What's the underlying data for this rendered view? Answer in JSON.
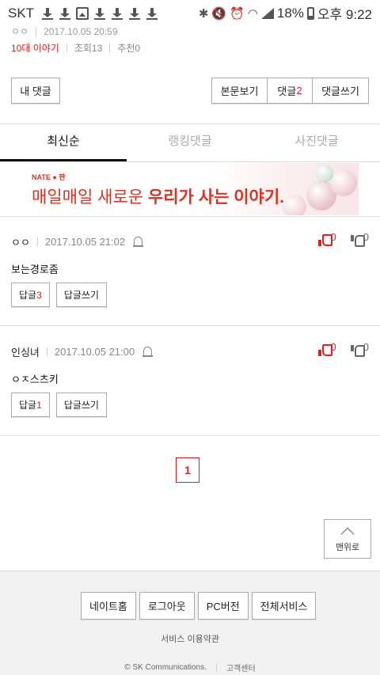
{
  "status_bar": {
    "carrier": "SKT",
    "battery": "18%",
    "time": "오후 9:22"
  },
  "post": {
    "author": "ㅇㅇ",
    "date": "2017.10.05 20:59",
    "category": "10대 이야기",
    "views": "조회13",
    "recommend": "추천0"
  },
  "toolbar": {
    "my_comments": "내 댓글",
    "view_post": "본문보기",
    "comments_label": "댓글",
    "comments_count": "2",
    "write_comment": "댓글쓰기"
  },
  "tabs": [
    {
      "label": "최신순",
      "active": true
    },
    {
      "label": "랭킹댓글",
      "active": false
    },
    {
      "label": "사진댓글",
      "active": false
    }
  ],
  "banner": {
    "brand": "NATE ● 판",
    "text_plain": "매일매일 새로운 ",
    "text_bold": "우리가 사는 이야기."
  },
  "comments": [
    {
      "author": "ㅇㅇ",
      "date": "2017.10.05 21:02",
      "body": "보는경로좀",
      "likes": "0",
      "dislikes": "0",
      "reply_label": "답글",
      "reply_count": "3",
      "write_reply": "답글쓰기"
    },
    {
      "author": "인싱녀",
      "date": "2017.10.05 21:00",
      "body": "ㅇㅈ스츠키",
      "likes": "0",
      "dislikes": "0",
      "reply_label": "답글",
      "reply_count": "1",
      "write_reply": "답글쓰기"
    }
  ],
  "pagination": {
    "current": "1"
  },
  "to_top": "맨위로",
  "footer": {
    "links": [
      "네이트홈",
      "로그아웃",
      "PC버전",
      "전체서비스"
    ],
    "terms": "서비스 이용약관",
    "copyright": "© SK Communications.",
    "support": "고객센터"
  },
  "colors": {
    "accent": "#e02020",
    "divider": "#e2e2e2",
    "footer_bg": "#f2f2f2"
  }
}
